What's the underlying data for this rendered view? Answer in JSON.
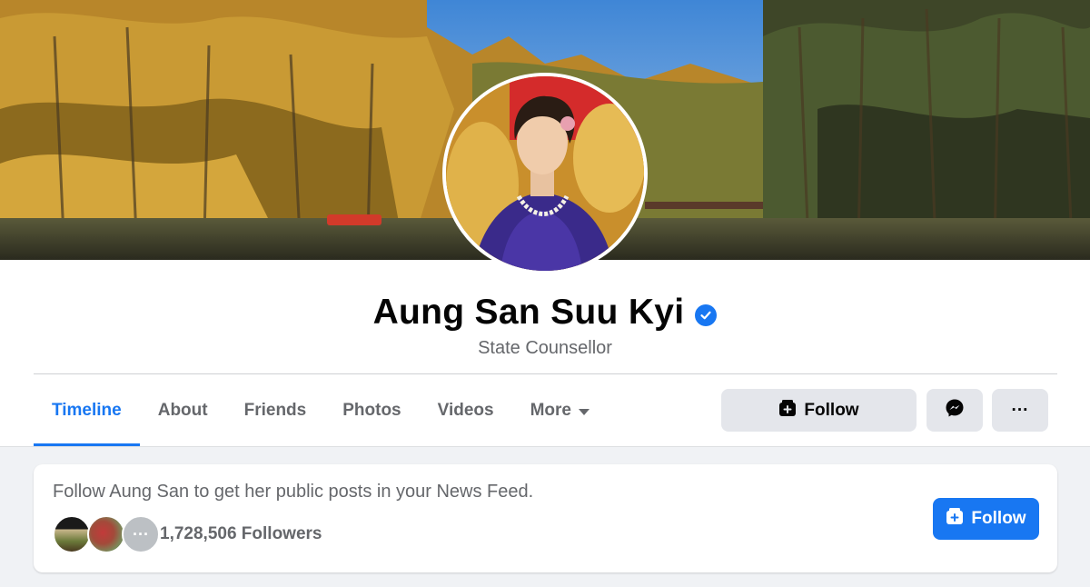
{
  "profile": {
    "name": "Aung San Suu Kyi",
    "subtitle": "State Counsellor"
  },
  "tabs": [
    {
      "label": "Timeline"
    },
    {
      "label": "About"
    },
    {
      "label": "Friends"
    },
    {
      "label": "Photos"
    },
    {
      "label": "Videos"
    },
    {
      "label": "More"
    }
  ],
  "actions": {
    "follow_label": "Follow",
    "more_glyph": "···"
  },
  "follow_card": {
    "message": "Follow Aung San to get her public posts in your News Feed.",
    "followers": "1,728,506 Followers",
    "more_faces_glyph": "···",
    "follow_label": "Follow"
  },
  "colors": {
    "accent": "#1877f2",
    "button_gray": "#e4e6eb",
    "text_secondary": "#65676b"
  },
  "icons": [
    "verified-badge-icon",
    "caret-down-icon",
    "follow-icon",
    "messenger-icon",
    "more-options-icon"
  ]
}
